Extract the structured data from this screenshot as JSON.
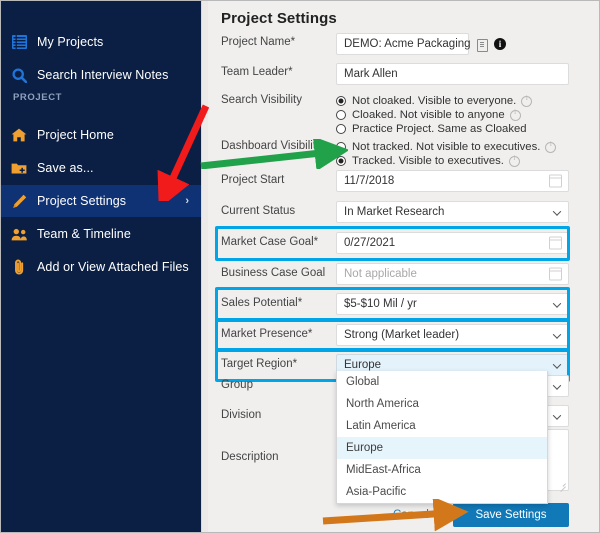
{
  "sidebar": {
    "section_label": "PROJECT",
    "items": [
      {
        "label": "My Projects",
        "icon": "list-icon",
        "active": false
      },
      {
        "label": "Search Interview Notes",
        "icon": "search-icon",
        "active": false
      },
      {
        "label": "Project Home",
        "icon": "home-icon",
        "active": false
      },
      {
        "label": "Save as...",
        "icon": "folder-add-icon",
        "active": false
      },
      {
        "label": "Project Settings",
        "icon": "pencil-icon",
        "active": true
      },
      {
        "label": "Team & Timeline",
        "icon": "people-icon",
        "active": false
      },
      {
        "label": "Add or View Attached Files",
        "icon": "paperclip-icon",
        "active": false
      }
    ],
    "chevron": "›"
  },
  "page": {
    "title": "Project Settings"
  },
  "fields": {
    "project_name": {
      "label": "Project Name*",
      "value": "DEMO: Acme Packaging"
    },
    "team_leader": {
      "label": "Team Leader*",
      "value": "Mark Allen"
    },
    "search_visibility": {
      "label": "Search Visibility",
      "options": [
        {
          "text": "Not cloaked. Visible to everyone.",
          "selected": true,
          "info": true
        },
        {
          "text": "Cloaked. Not visible to anyone",
          "selected": false,
          "info": true
        },
        {
          "text": "Practice Project. Same as Cloaked",
          "selected": false,
          "info": false
        }
      ]
    },
    "dashboard_visibility": {
      "label": "Dashboard Visibility",
      "options": [
        {
          "text": "Not tracked. Not visible to executives.",
          "selected": false,
          "info": true
        },
        {
          "text": "Tracked. Visible to executives.",
          "selected": true,
          "info": true
        }
      ]
    },
    "project_start": {
      "label": "Project Start",
      "value": "11/7/2018"
    },
    "current_status": {
      "label": "Current Status",
      "value": "In Market Research"
    },
    "market_case_goal": {
      "label": "Market Case Goal*",
      "value": "0/27/2021",
      "highlighted": true
    },
    "business_case_goal": {
      "label": "Business Case Goal",
      "value": "",
      "placeholder": "Not applicable"
    },
    "sales_potential": {
      "label": "Sales Potential*",
      "value": "$5-$10 Mil / yr",
      "highlighted": true
    },
    "market_presence": {
      "label": "Market Presence*",
      "value": "Strong (Market leader)",
      "highlighted": true
    },
    "target_region": {
      "label": "Target Region*",
      "value": "Europe",
      "highlighted": true,
      "open": true
    },
    "group": {
      "label": "Group",
      "value": ""
    },
    "division": {
      "label": "Division",
      "value": ""
    },
    "description": {
      "label": "Description",
      "value": ""
    }
  },
  "region_dropdown": {
    "options": [
      "Global",
      "North America",
      "Latin America",
      "Europe",
      "MidEast-Africa",
      "Asia-Pacific"
    ],
    "selected": "Europe"
  },
  "footer": {
    "cancel_label": "Cancel",
    "save_label": "Save Settings"
  },
  "annotations": {
    "red_arrow": "points to Project Settings",
    "green_arrow": "points to Tracked radio",
    "orange_arrow": "points to Save Settings button"
  },
  "colors": {
    "sidebar_bg": "#0b1f44",
    "sidebar_active": "#0f3275",
    "icon_orange": "#f0a030",
    "highlight_cyan": "#00a5e8",
    "save_blue": "#1279b8",
    "link_blue": "#1b7fbf",
    "red_arrow": "#f21b1b",
    "green_arrow": "#22a14b",
    "orange_arrow": "#d2771a"
  }
}
